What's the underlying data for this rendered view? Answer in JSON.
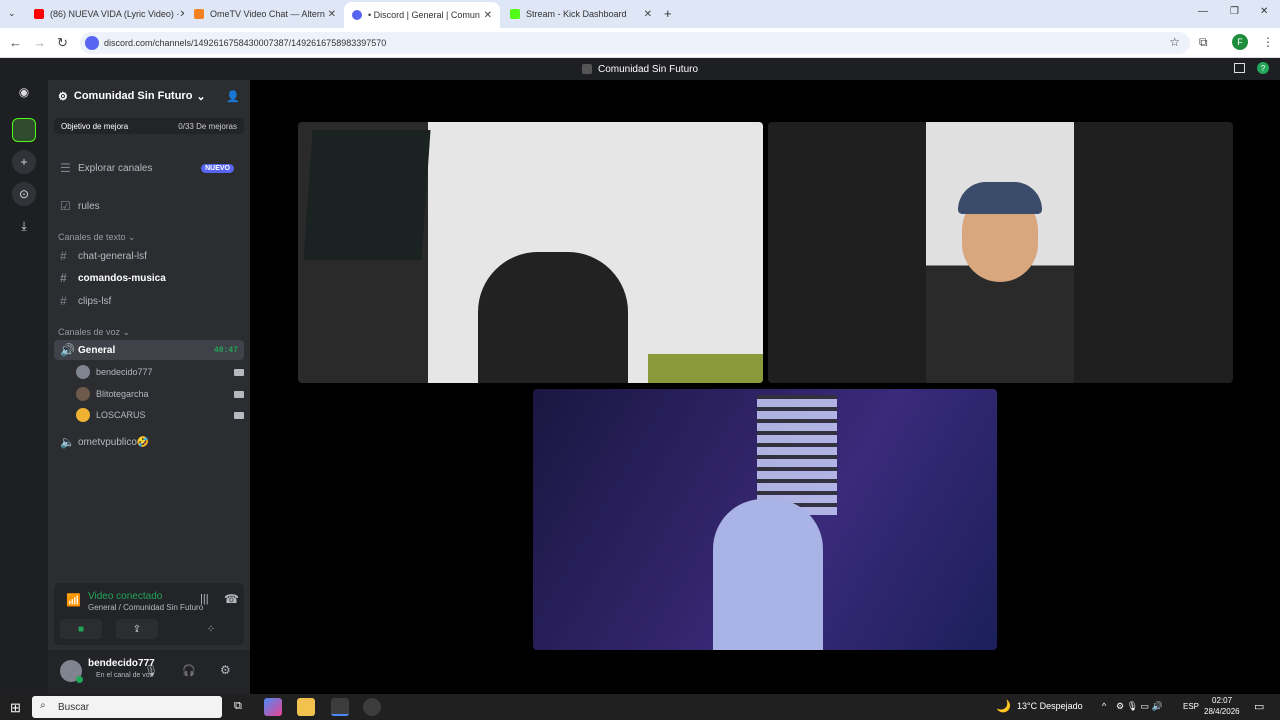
{
  "browser": {
    "tabs": [
      {
        "title": "(86) NUEVA VIDA (Lyric Video) ·",
        "active": false,
        "color": "#ff0000"
      },
      {
        "title": "OmeTV Video Chat — Altern",
        "active": false,
        "color": "#f58220"
      },
      {
        "title": "• Discord | General | Comun",
        "active": true,
        "color": "#5865f2"
      },
      {
        "title": "Stream - Kick Dashboard",
        "active": false,
        "color": "#53fc18"
      }
    ],
    "url": "discord.com/channels/1492616758430007387/1492616758983397570",
    "profile_initial": "F"
  },
  "window_title": "Comunidad Sin Futuro",
  "server": {
    "name": "Comunidad Sin Futuro",
    "boost_label": "Objetivo de mejora",
    "boost_progress": "0/33 De mejoras",
    "explore_label": "Explorar canales",
    "new_badge": "NUEVO",
    "rules": "rules",
    "text_category": "Canales de texto",
    "text_channels": [
      "chat-general-lsf",
      "comandos-musica",
      "clips-lsf"
    ],
    "voice_category": "Canales de voz",
    "voice_channel": "General",
    "voice_timer": "40:47",
    "voice_users": [
      {
        "name": "bendecido777",
        "color": "#80848e"
      },
      {
        "name": "Blitotegarcha",
        "color": "#6d5a4a"
      },
      {
        "name": "LOSCARUS",
        "color": "#f0b232"
      }
    ],
    "second_voice": "ometvpublico🤣"
  },
  "voice_panel": {
    "status": "Video conectado",
    "sub": "General / Comunidad Sin Futuro"
  },
  "user": {
    "name": "bendecido777",
    "status": "En el canal de voz"
  },
  "taskbar": {
    "search": "Buscar",
    "weather": "13°C  Despejado",
    "lang": "ESP",
    "time": "02:07",
    "date": "28/4/2026"
  },
  "colors": {
    "accent": "#5865f2",
    "green": "#23a55a"
  }
}
